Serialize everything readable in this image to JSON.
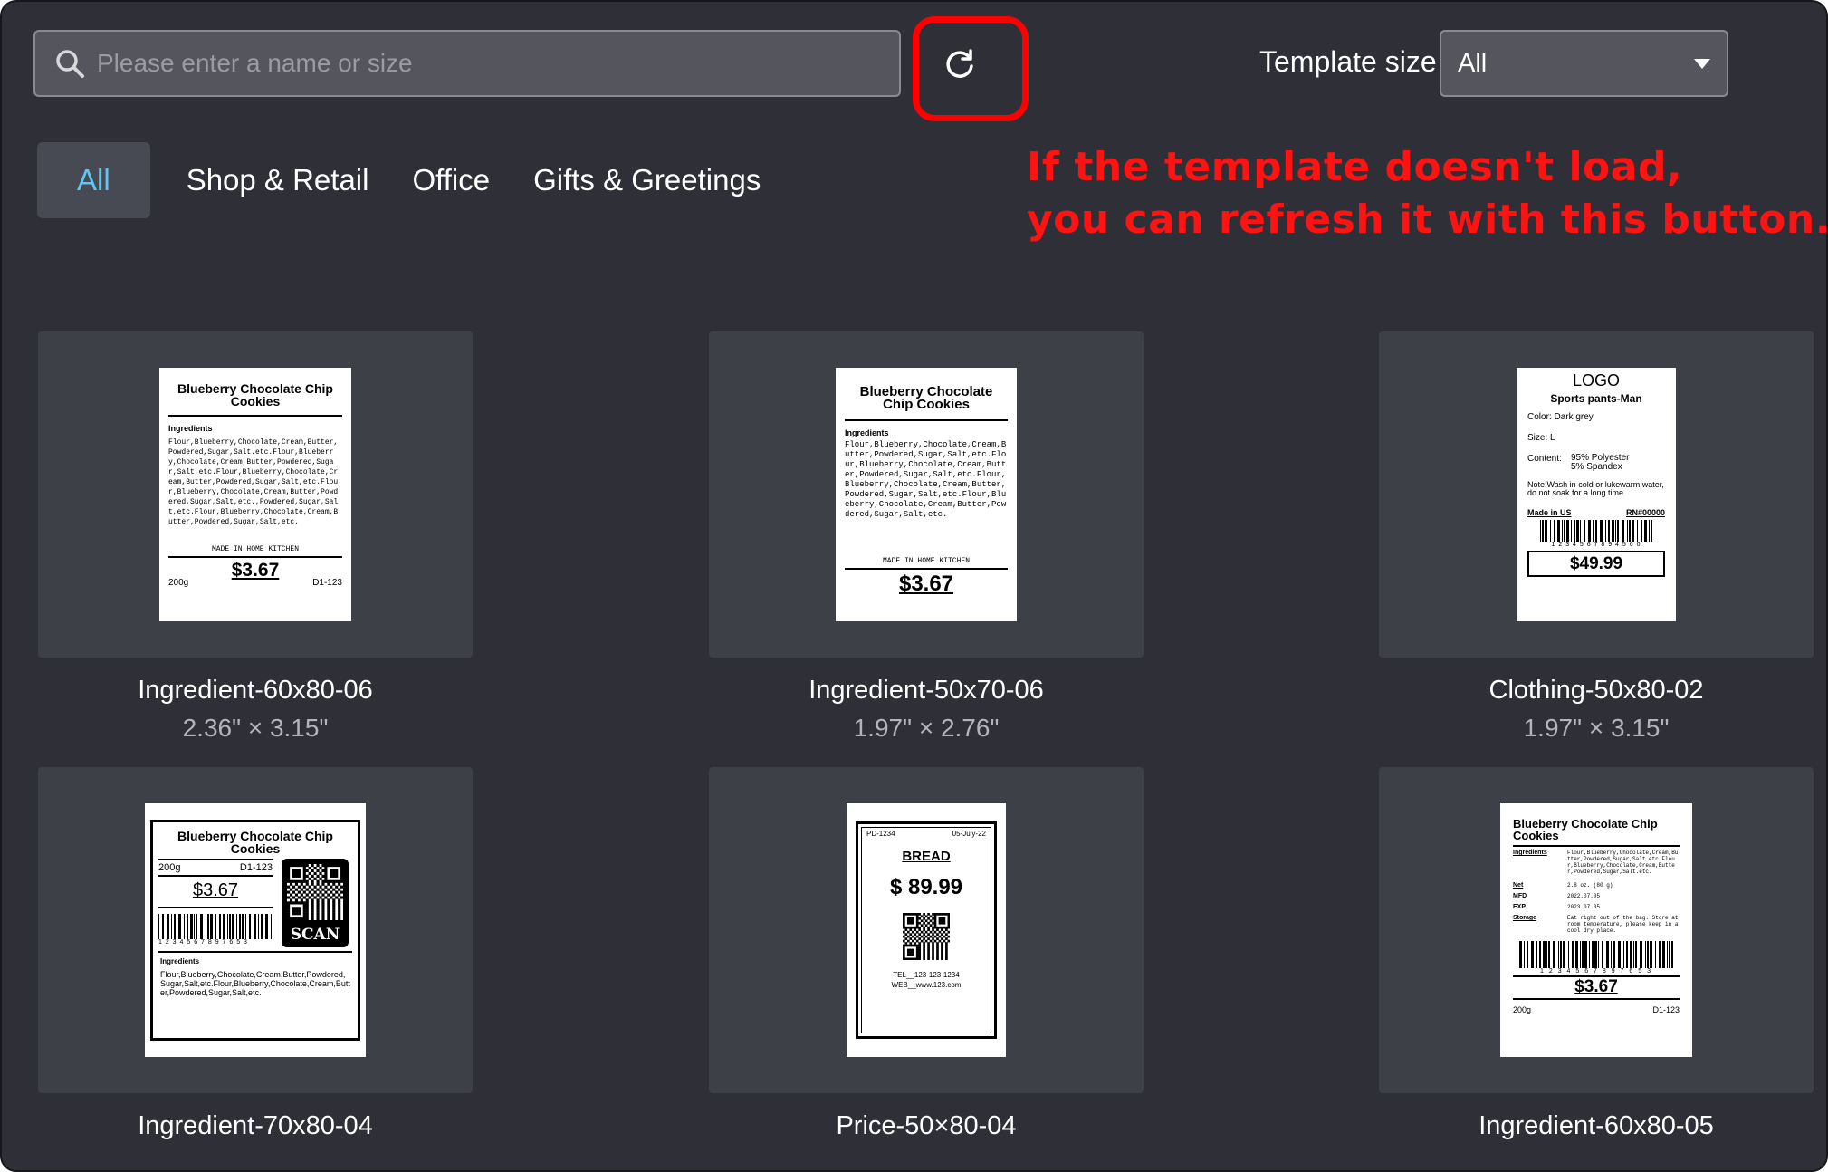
{
  "search": {
    "placeholder": "Please enter a name or size"
  },
  "toolbar": {
    "refresh_label": ""
  },
  "template_size": {
    "label": "Template size",
    "selected": "All"
  },
  "tabs": [
    {
      "label": "All",
      "active": true
    },
    {
      "label": "Shop & Retail",
      "active": false
    },
    {
      "label": "Office",
      "active": false
    },
    {
      "label": "Gifts & Greetings",
      "active": false
    }
  ],
  "annotation": {
    "line1": "If the template doesn't load,",
    "line2": "you can refresh it with this button.",
    "color": "#ff0000"
  },
  "colors": {
    "background": "#2f3037",
    "card": "#3e4047",
    "accent": "#5fc8f2",
    "input": "#55565d"
  },
  "templates": [
    {
      "name": "Ingredient-60x80-06",
      "size": "2.36\" × 3.15\"",
      "preview": {
        "title": "Blueberry Chocolate Chip Cookies",
        "section": "Ingredients",
        "body": "Flour,Blueberry,Chocolate,Cream,Butter,Powdered,Sugar,Salt.etc.Flour,Blueberry,Chocolate,Cream,Butter,Powdered,Sugar,Salt,etc.Flour,Blueberry,Chocolate,Cream,Butter,Powdered,Sugar,Salt,etc.Flour,Blueberry,Chocolate,Cream,Butter,Powdered,Sugar,Salt,etc.,Powdered,Sugar,Salt,etc.Flour,Blueberry,Chocolate,Cream,Butter,Powdered,Sugar,Salt,etc.",
        "made": "MADE IN HOME KITCHEN",
        "price": "$3.67",
        "weight": "200g",
        "code": "D1-123"
      }
    },
    {
      "name": "Ingredient-50x70-06",
      "size": "1.97\" × 2.76\"",
      "preview": {
        "title": "Blueberry Chocolate Chip Cookies",
        "section": "Ingredients",
        "body": "Flour,Blueberry,Chocolate,Cream,Butter,Powdered,Sugar,Salt,etc.Flour,Blueberry,Chocolate,Cream,Butter,Powdered,Sugar,Salt,etc.Flour,Blueberry,Chocolate,Cream,Butter,Powdered,Sugar,Salt,etc.Flour,Blueberry,Chocolate,Cream,Butter,Powdered,Sugar,Salt,etc.",
        "made": "MADE IN HOME KITCHEN",
        "price": "$3.67"
      }
    },
    {
      "name": "Clothing-50x80-02",
      "size": "1.97\" × 3.15\"",
      "preview": {
        "logo": "LOGO",
        "title": "Sports pants-Man",
        "color": "Color: Dark grey",
        "size": "Size: L",
        "content_label": "Content:",
        "content1": "95% Polyester",
        "content2": "5% Spandex",
        "note": "Note:Wash in cold or lukewarm water, do not soak for a long time",
        "made": "Made in US",
        "rn": "RN#00000",
        "digits": "1 2 3 4 5 6 7 8 9 4 5 6 0",
        "price": "$49.99"
      }
    },
    {
      "name": "Ingredient-70x80-04",
      "size": "",
      "preview": {
        "title": "Blueberry Chocolate Chip Cookies",
        "weight": "200g",
        "code": "D1-123",
        "price": "$3.67",
        "scan": "SCAN",
        "digits": "1 2 3 4 5 6 7 8 9 7 6 5 3",
        "section": "Ingredients",
        "body": "Flour,Blueberry,Chocolate,Cream,Butter,Powdered,Sugar,Salt,etc.Flour,Blueberry,Chocolate,Cream,Butter,Powdered,Sugar,Salt,etc."
      }
    },
    {
      "name": "Price-50×80-04",
      "size": "",
      "preview": {
        "code": "PD-1234",
        "date": "05-July-22",
        "title": "BREAD",
        "price": "$ 89.99",
        "tel": "TEL__123-123-1234",
        "web": "WEB__www.123.com"
      }
    },
    {
      "name": "Ingredient-60x80-05",
      "size": "",
      "preview": {
        "title": "Blueberry Chocolate Chip Cookies",
        "ingredients_label": "Ingredients",
        "ingredients": "Flour,Blueberry,Chocolate,Cream,Butter,Powdered,Sugar,Salt.etc.Flour,Blueberry,Chocolate,Cream,Butter,Powdered,Sugar,Salt.etc.",
        "net_label": "Net",
        "net": "2.8 oz. (80 g)",
        "mfd_label": "MFD",
        "mfd": "2022.07.05",
        "exp_label": "EXP",
        "exp": "2023.07.05",
        "storage_label": "Storage",
        "storage": "Eat right out of the bag. Store at room temperature, please keep in a cool dry place.",
        "digits": "1 2 3 4 5 6 7 8 9 7 6 5 3",
        "price": "$3.67",
        "weight": "200g",
        "code": "D1-123"
      }
    }
  ]
}
